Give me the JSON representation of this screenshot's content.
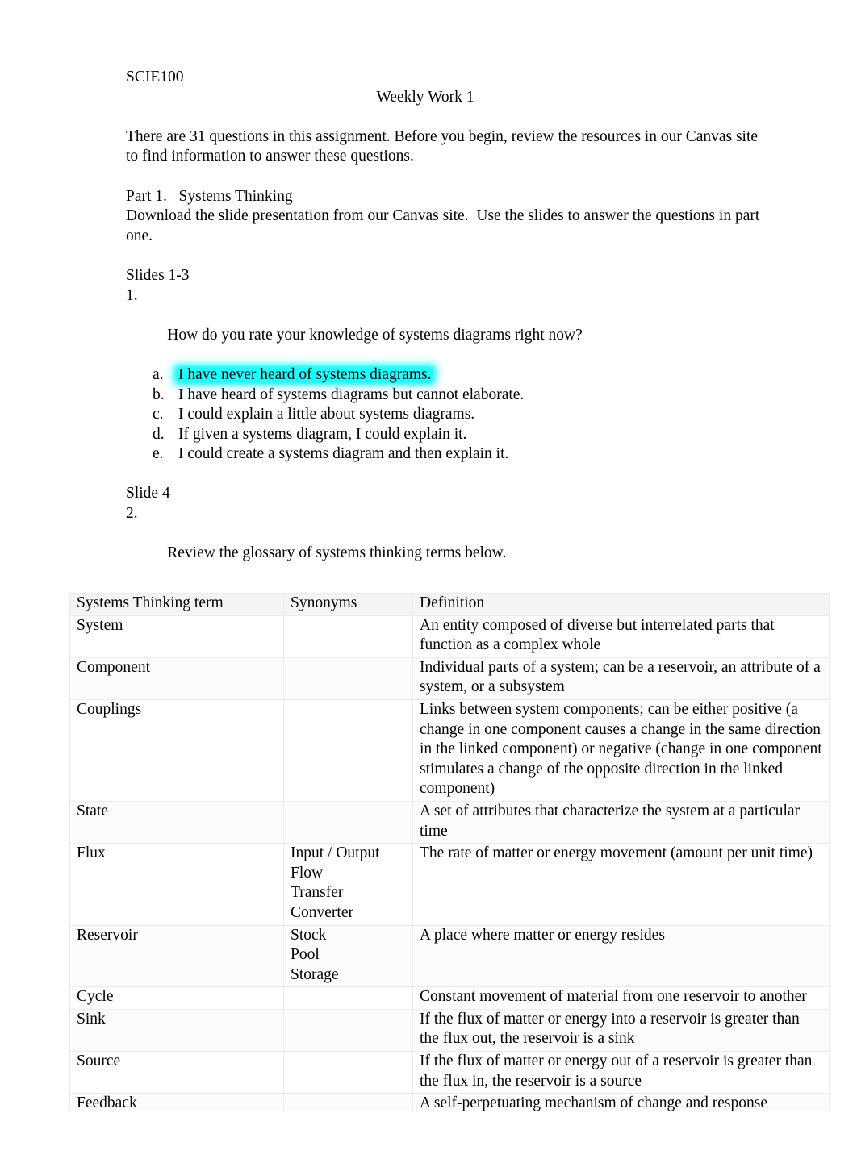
{
  "document": {
    "course_code": "SCIE100",
    "title": "Weekly Work 1",
    "intro_paragraph": "There are 31 questions in this assignment. Before you begin, review the resources in our Canvas site to find information to answer these questions.",
    "part_heading": "Part 1.   Systems Thinking",
    "part_instructions": "Download the slide presentation from our Canvas site.  Use the slides to answer the questions in part one.",
    "slides_heading_1": "Slides 1-3",
    "question_1": {
      "marker": "1.",
      "text": "How do you rate your knowledge of systems diagrams right now?",
      "options": [
        {
          "marker": "a.",
          "text": "I have never heard of systems diagrams.",
          "highlighted": true
        },
        {
          "marker": "b.",
          "text": "I have heard of systems diagrams but cannot elaborate.",
          "highlighted": false
        },
        {
          "marker": "c.",
          "text": "I could explain a little about systems diagrams.",
          "highlighted": false
        },
        {
          "marker": "d.",
          "text": "If given a systems diagram, I could explain it.",
          "highlighted": false
        },
        {
          "marker": "e.",
          "text": "I could create a systems diagram and then explain it.",
          "highlighted": false
        }
      ]
    },
    "slides_heading_2": "Slide 4",
    "question_2": {
      "marker": "2.",
      "text": "Review the glossary of systems thinking terms below."
    },
    "highlight_color": "#18ffff"
  },
  "glossary": {
    "headers": [
      "Systems Thinking term",
      "Synonyms",
      "Definition"
    ],
    "rows": [
      {
        "term": "System",
        "synonyms": [],
        "definition": "An entity composed of diverse but interrelated parts that function as a complex whole"
      },
      {
        "term": "Component",
        "synonyms": [],
        "definition": "Individual parts of a system; can be a reservoir, an attribute of a system, or a subsystem"
      },
      {
        "term": "Couplings",
        "synonyms": [],
        "definition": "Links between system components; can be either positive (a change in one component causes a change in the same direction in the linked component) or negative (change in one component stimulates a change of the opposite direction in the linked component)"
      },
      {
        "term": "State",
        "synonyms": [],
        "definition": "A set of attributes that characterize the system at a particular time"
      },
      {
        "term": "Flux",
        "synonyms": [
          "Input / Output",
          "Flow",
          "Transfer",
          "Converter"
        ],
        "definition": "The rate of matter or energy movement (amount per unit time)"
      },
      {
        "term": "Reservoir",
        "synonyms": [
          "Stock",
          "Pool",
          "Storage"
        ],
        "definition": "A place where matter or energy resides"
      },
      {
        "term": "Cycle",
        "synonyms": [],
        "definition": "Constant movement of material from one reservoir to another"
      },
      {
        "term": "Sink",
        "synonyms": [],
        "definition": "If the flux of matter or energy into a reservoir is greater than the flux out, the reservoir is a sink"
      },
      {
        "term": "Source",
        "synonyms": [],
        "definition": "If the flux of matter or energy out of a reservoir is greater than the flux in, the reservoir is a source"
      },
      {
        "term": "Feedback",
        "synonyms": [],
        "definition": "A self-perpetuating mechanism of change and response"
      }
    ]
  }
}
